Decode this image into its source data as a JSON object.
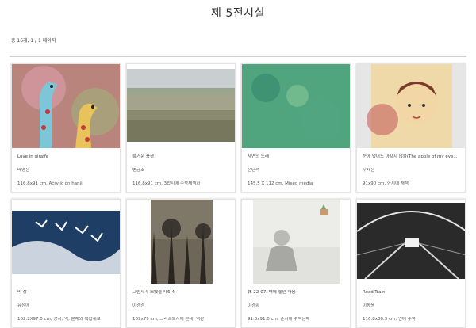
{
  "page": {
    "title": "제 5전시실",
    "count_text": "총 16개, 1 / 1 페이지"
  },
  "artworks": [
    {
      "title": "Love in giraffe",
      "artist": "배영은",
      "detail": "116.8x91 cm, Acrylic on hanji"
    },
    {
      "title": "즐거운 풍경",
      "artist": "변금조",
      "detail": "116.8x91 cm, 3합지에 수묵채색화"
    },
    {
      "title": "자연의 노래",
      "artist": "은난숙",
      "detail": "145.5 X 112 cm, Mixed media"
    },
    {
      "title": "눈에 넣어도 아프지 않을(The apple of my eye...",
      "artist": "우새은",
      "detail": "91x90 cm, 한지에 채색"
    },
    {
      "title": "비 상",
      "artist": "유정애",
      "detail": "162.2X97.0 cm, 장지, 먹, 분채와 복합재료"
    },
    {
      "title": "그림자가 모였을 때6-4.",
      "artist": "이경경",
      "detail": "109x79 cm, 크라프트지에 콘테, 먹판"
    },
    {
      "title": "休 22-07. 벽에 놓인 마음",
      "artist": "이경화",
      "detail": "91.0x91.0 cm, 순지에 수묵담채"
    },
    {
      "title": "Road-Train",
      "artist": "이동윤",
      "detail": "116.8x80.3 cm, 면에 수묵"
    }
  ]
}
